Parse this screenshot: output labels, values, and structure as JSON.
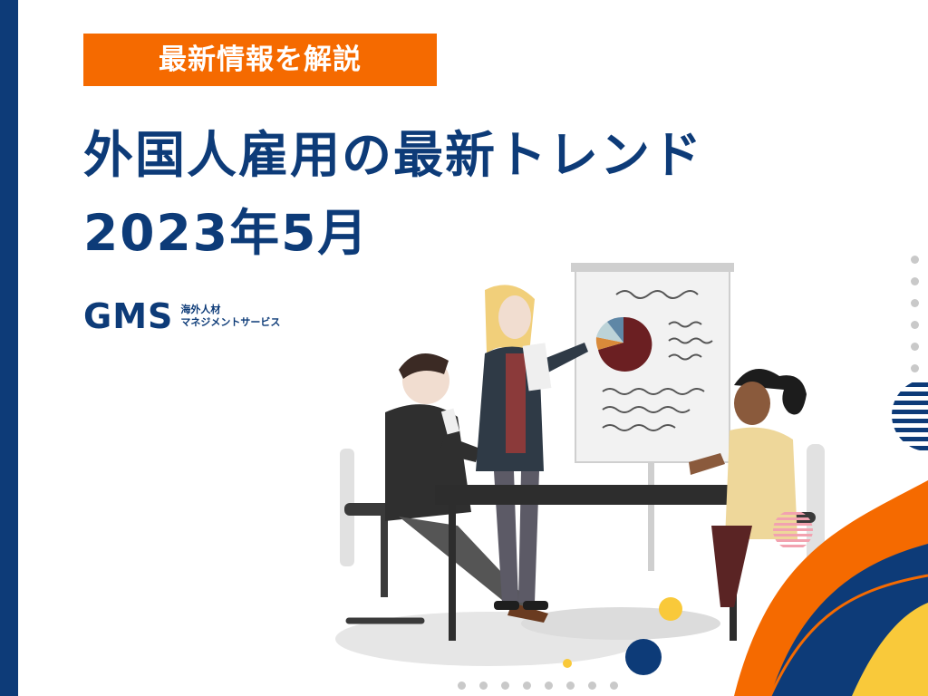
{
  "banner": {
    "label": "最新情報を解説"
  },
  "title": {
    "line1": "外国人雇用の最新トレンド",
    "line2": "2023年5月"
  },
  "logo": {
    "mark": "GMS",
    "sub_line1": "海外人材",
    "sub_line2": "マネジメントサービス"
  },
  "illustration": {
    "icon": "business-meeting-illustration"
  },
  "colors": {
    "brand_navy": "#0d3b78",
    "accent_orange": "#f56a00",
    "accent_yellow": "#f9c93a",
    "accent_pink": "#f2a2b0"
  }
}
